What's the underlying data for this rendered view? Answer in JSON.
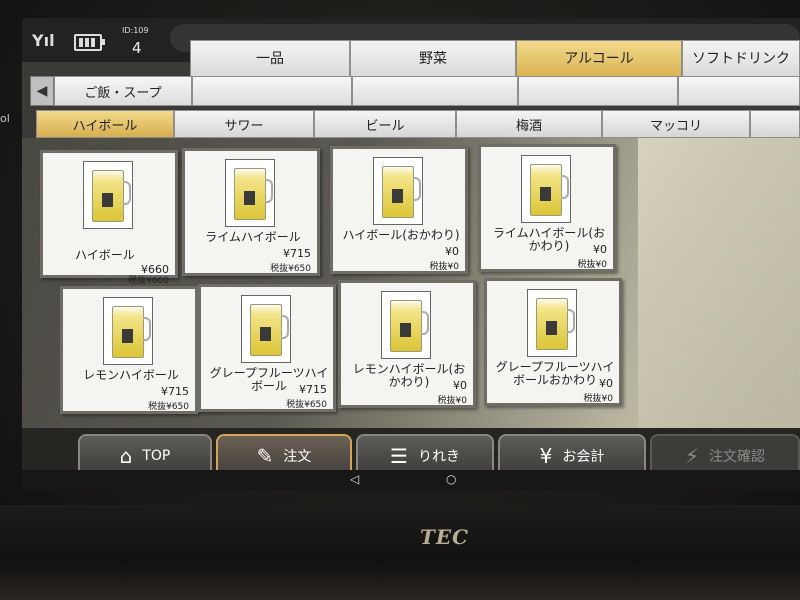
{
  "side_text": "ol",
  "brand": "TEC",
  "status": {
    "id_label": "ID:109",
    "id_num": "4"
  },
  "categories": [
    "一品",
    "野菜",
    "アルコール",
    "ソフトドリンク"
  ],
  "nav": {
    "back": "◀",
    "items": [
      "ご飯・スープ",
      "",
      "",
      "",
      "",
      ""
    ]
  },
  "subtabs": [
    "ハイボール",
    "サワー",
    "ビール",
    "梅酒",
    "マッコリ"
  ],
  "products": [
    {
      "name": "ハイボール",
      "price": "¥660",
      "notax": "税抜¥600"
    },
    {
      "name": "ライムハイボール",
      "price": "¥715",
      "notax": "税抜¥650"
    },
    {
      "name": "ハイボール(おかわり)",
      "price": "¥0",
      "notax": "税抜¥0"
    },
    {
      "name": "ライムハイボール(おかわり)",
      "price": "¥0",
      "notax": "税抜¥0"
    },
    {
      "name": "レモンハイボール",
      "price": "¥715",
      "notax": "税抜¥650"
    },
    {
      "name": "グレープフルーツハイボール",
      "price": "¥715",
      "notax": "税抜¥650"
    },
    {
      "name": "レモンハイボール(おかわり)",
      "price": "¥0",
      "notax": "税抜¥0"
    },
    {
      "name": "グレープフルーツハイボールおかわり",
      "price": "¥0",
      "notax": "税抜¥0"
    }
  ],
  "bottom": {
    "top": "TOP",
    "order": "注文",
    "history": "りれき",
    "checkout": "お会計",
    "confirm": "注文確認"
  },
  "icons": {
    "home": "home-icon",
    "order": "edit-icon",
    "history": "history-list-icon",
    "checkout": "yen-icon",
    "confirm": "lightning-icon"
  },
  "colors": {
    "active_tab": "#e2bd5f",
    "order_border": "#d3a45a"
  }
}
